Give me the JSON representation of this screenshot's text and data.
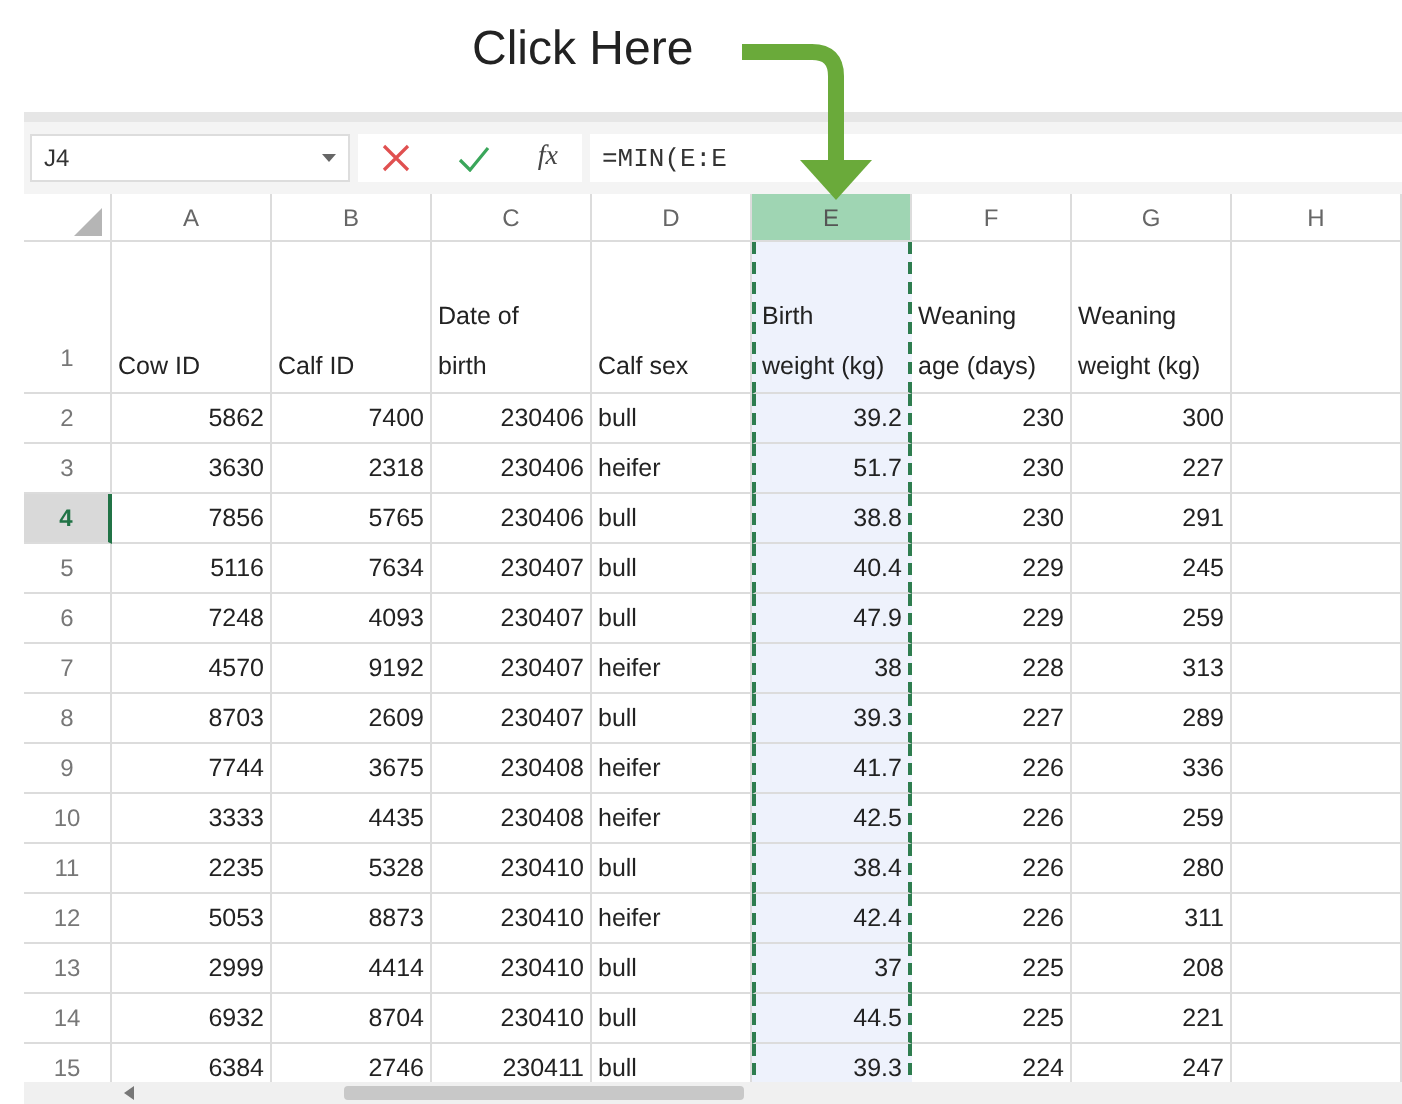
{
  "caption": {
    "text": "Click Here"
  },
  "formula_bar": {
    "name_box": "J4",
    "function_label": "fx",
    "formula": "=MIN(E:E"
  },
  "columns": [
    {
      "label": "A",
      "selected": false,
      "kind": "number"
    },
    {
      "label": "B",
      "selected": false,
      "kind": "number"
    },
    {
      "label": "C",
      "selected": false,
      "kind": "number"
    },
    {
      "label": "D",
      "selected": false,
      "kind": "text"
    },
    {
      "label": "E",
      "selected": true,
      "kind": "number"
    },
    {
      "label": "F",
      "selected": false,
      "kind": "number"
    },
    {
      "label": "G",
      "selected": false,
      "kind": "number"
    },
    {
      "label": "H",
      "selected": false,
      "kind": "number"
    }
  ],
  "rows": [
    {
      "number": "1",
      "kind": "header",
      "selected": false,
      "cells": [
        "Cow ID",
        "Calf ID",
        "Date of birth",
        "Calf sex",
        "Birth weight (kg)",
        "Weaning age (days)",
        "Weaning weight (kg)"
      ]
    },
    {
      "number": "2",
      "kind": "data",
      "selected": false,
      "cells": [
        "5862",
        "7400",
        "230406",
        "bull",
        "39.2",
        "230",
        "300"
      ]
    },
    {
      "number": "3",
      "kind": "data",
      "selected": false,
      "cells": [
        "3630",
        "2318",
        "230406",
        "heifer",
        "51.7",
        "230",
        "227"
      ]
    },
    {
      "number": "4",
      "kind": "data",
      "selected": true,
      "cells": [
        "7856",
        "5765",
        "230406",
        "bull",
        "38.8",
        "230",
        "291"
      ]
    },
    {
      "number": "5",
      "kind": "data",
      "selected": false,
      "cells": [
        "5116",
        "7634",
        "230407",
        "bull",
        "40.4",
        "229",
        "245"
      ]
    },
    {
      "number": "6",
      "kind": "data",
      "selected": false,
      "cells": [
        "7248",
        "4093",
        "230407",
        "bull",
        "47.9",
        "229",
        "259"
      ]
    },
    {
      "number": "7",
      "kind": "data",
      "selected": false,
      "cells": [
        "4570",
        "9192",
        "230407",
        "heifer",
        "38",
        "228",
        "313"
      ]
    },
    {
      "number": "8",
      "kind": "data",
      "selected": false,
      "cells": [
        "8703",
        "2609",
        "230407",
        "bull",
        "39.3",
        "227",
        "289"
      ]
    },
    {
      "number": "9",
      "kind": "data",
      "selected": false,
      "cells": [
        "7744",
        "3675",
        "230408",
        "heifer",
        "41.7",
        "226",
        "336"
      ]
    },
    {
      "number": "10",
      "kind": "data",
      "selected": false,
      "cells": [
        "3333",
        "4435",
        "230408",
        "heifer",
        "42.5",
        "226",
        "259"
      ]
    },
    {
      "number": "11",
      "kind": "data",
      "selected": false,
      "cells": [
        "2235",
        "5328",
        "230410",
        "bull",
        "38.4",
        "226",
        "280"
      ]
    },
    {
      "number": "12",
      "kind": "data",
      "selected": false,
      "cells": [
        "5053",
        "8873",
        "230410",
        "heifer",
        "42.4",
        "226",
        "311"
      ]
    },
    {
      "number": "13",
      "kind": "data",
      "selected": false,
      "cells": [
        "2999",
        "4414",
        "230410",
        "bull",
        "37",
        "225",
        "208"
      ]
    },
    {
      "number": "14",
      "kind": "data",
      "selected": false,
      "cells": [
        "6932",
        "8704",
        "230410",
        "bull",
        "44.5",
        "225",
        "221"
      ]
    },
    {
      "number": "15",
      "kind": "data",
      "selected": false,
      "cells": [
        "6384",
        "2746",
        "230411",
        "bull",
        "39.3",
        "224",
        "247"
      ]
    }
  ]
}
